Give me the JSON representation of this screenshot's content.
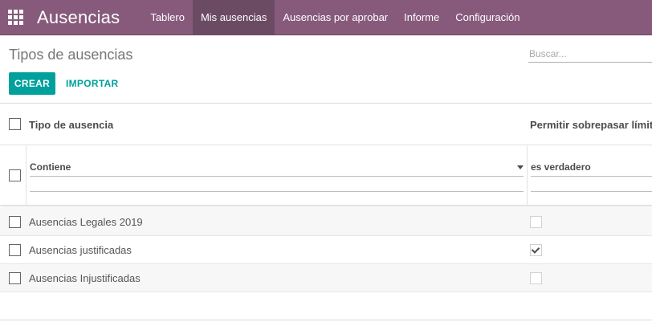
{
  "navbar": {
    "app_icon": "apps-grid-icon",
    "brand": "Ausencias",
    "menu": [
      {
        "label": "Tablero",
        "active": false
      },
      {
        "label": "Mis ausencias",
        "active": true
      },
      {
        "label": "Ausencias por aprobar",
        "active": false
      },
      {
        "label": "Informe",
        "active": false
      },
      {
        "label": "Configuración",
        "active": false
      }
    ],
    "color": "#875a7b",
    "active_color": "#6b4b63"
  },
  "control_panel": {
    "breadcrumb": "Tipos de ausencias",
    "search_placeholder": "Buscar...",
    "create_label": "CREAR",
    "import_label": "IMPORTAR",
    "accent_color": "#00a09d"
  },
  "list": {
    "columns": [
      "Tipo de ausencia",
      "Permitir sobrepasar límite"
    ],
    "filters": {
      "name_operator": "Contiene",
      "allow_operator": "es verdadero"
    },
    "rows": [
      {
        "name": "Ausencias Legales 2019",
        "allow_exceed": false
      },
      {
        "name": "Ausencias justificadas",
        "allow_exceed": true
      },
      {
        "name": "Ausencias Injustificadas",
        "allow_exceed": false
      }
    ]
  }
}
